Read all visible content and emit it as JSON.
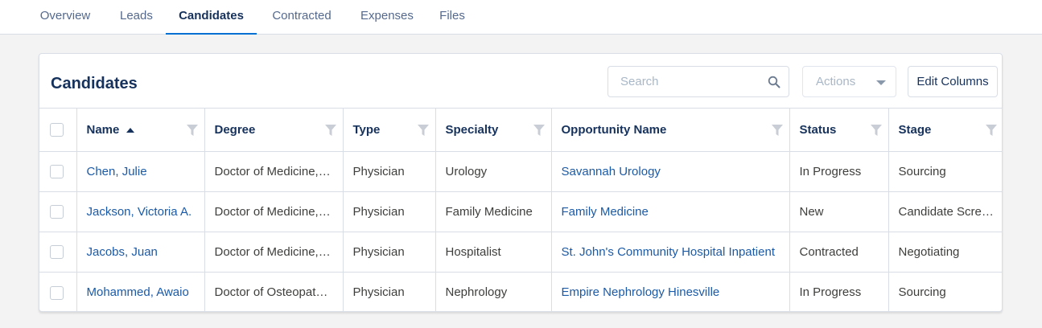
{
  "tabs": [
    {
      "label": "Overview"
    },
    {
      "label": "Leads"
    },
    {
      "label": "Candidates",
      "active": true
    },
    {
      "label": "Contracted"
    },
    {
      "label": "Expenses"
    },
    {
      "label": "Files"
    }
  ],
  "card": {
    "title": "Candidates",
    "search_placeholder": "Search",
    "actions_label": "Actions",
    "edit_columns_label": "Edit Columns"
  },
  "table": {
    "columns": [
      "Name",
      "Degree",
      "Type",
      "Specialty",
      "Opportunity Name",
      "Status",
      "Stage"
    ],
    "sorted_column": "Name",
    "sort_direction": "ascending",
    "rows": [
      {
        "name": "Chen, Julie",
        "degree": "Doctor of Medicine,…",
        "type": "Physician",
        "specialty": "Urology",
        "opportunity": "Savannah Urology",
        "status": "In Progress",
        "stage": "Sourcing"
      },
      {
        "name": "Jackson, Victoria A.",
        "degree": "Doctor of Medicine,…",
        "type": "Physician",
        "specialty": "Family Medicine",
        "opportunity": "Family Medicine",
        "status": "New",
        "stage": "Candidate Scree…"
      },
      {
        "name": "Jacobs, Juan",
        "degree": "Doctor of Medicine,…",
        "type": "Physician",
        "specialty": "Hospitalist",
        "opportunity": "St. John's Community Hospital Inpatient",
        "status": "Contracted",
        "stage": "Negotiating"
      },
      {
        "name": "Mohammed, Awaio",
        "degree": "Doctor of Osteopat…",
        "type": "Physician",
        "specialty": "Nephrology",
        "opportunity": "Empire Nephrology Hinesville",
        "status": "In Progress",
        "stage": "Sourcing"
      }
    ]
  },
  "colors": {
    "link": "#1b5aa6",
    "active_tab_underline": "#0070d2",
    "heading": "#16325c"
  }
}
